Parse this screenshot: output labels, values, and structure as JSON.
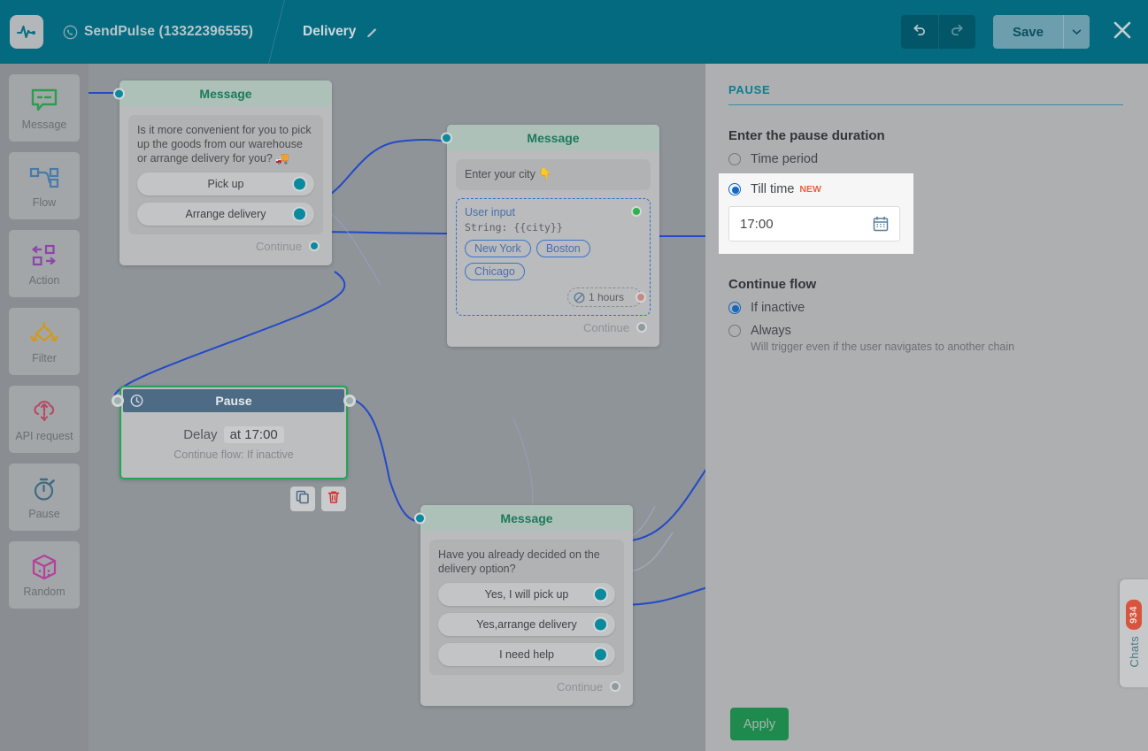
{
  "header": {
    "logo_icon": "pulse-logo-icon",
    "account_icon": "whatsapp-icon",
    "account": "SendPulse (13322396555)",
    "flow_name": "Delivery",
    "edit_icon": "pencil-icon",
    "undo_icon": "undo-icon",
    "redo_icon": "redo-icon",
    "save_label": "Save",
    "save_caret_icon": "chevron-down-icon",
    "close_icon": "close-icon"
  },
  "sidebar": {
    "items": [
      {
        "label": "Message",
        "icon": "message-bubble-icon",
        "color": "#2e9b4f"
      },
      {
        "label": "Flow",
        "icon": "flow-nodes-icon",
        "color": "#4a7aa8"
      },
      {
        "label": "Action",
        "icon": "action-arrows-icon",
        "color": "#8c46a8"
      },
      {
        "label": "Filter",
        "icon": "filter-diamond-icon",
        "color": "#d2991f"
      },
      {
        "label": "API request",
        "icon": "api-cloud-icon",
        "color": "#b84a63"
      },
      {
        "label": "Pause",
        "icon": "stopwatch-icon",
        "color": "#3f6b86"
      },
      {
        "label": "Random",
        "icon": "dice-icon",
        "color": "#b5409b"
      }
    ]
  },
  "canvas": {
    "nodes": {
      "message1": {
        "title": "Message",
        "text": "Is it more convenient for you to pick up the goods from our warehouse or arrange delivery for you? 🚚",
        "buttons": [
          "Pick up",
          "Arrange delivery"
        ],
        "continue_label": "Continue"
      },
      "message2": {
        "title": "Message",
        "text": "Enter your city 👇",
        "user_input": {
          "title": "User input",
          "subtitle": "String: {{city}}",
          "chips": [
            "New York",
            "Boston",
            "Chicago"
          ],
          "timeout_label": "1 hours",
          "timeout_icon": "no-entry-icon"
        },
        "continue_label": "Continue"
      },
      "pause": {
        "title": "Pause",
        "icon": "clock-icon",
        "delay_label": "Delay",
        "delay_value": "at 17:00",
        "subtitle": "Continue flow: If inactive",
        "actions": {
          "copy_icon": "copy-icon",
          "delete_icon": "trash-icon"
        }
      },
      "message3": {
        "title": "Message",
        "text": "Have you already decided on the delivery option?",
        "buttons": [
          "Yes, I will pick up",
          "Yes,arrange delivery",
          "I need help"
        ],
        "continue_label": "Continue"
      }
    }
  },
  "panel": {
    "title": "PAUSE",
    "duration_heading": "Enter the pause duration",
    "duration_options": [
      {
        "label": "Time period",
        "selected": false,
        "badge": ""
      },
      {
        "label": "Till time",
        "selected": true,
        "badge": "NEW"
      }
    ],
    "time_value": "17:00",
    "calendar_icon": "calendar-icon",
    "continue_heading": "Continue flow",
    "continue_options": [
      {
        "label": "If inactive",
        "selected": true
      },
      {
        "label": "Always",
        "selected": false
      }
    ],
    "always_hint": "Will trigger even if the user navigates to another chain",
    "apply_label": "Apply"
  },
  "chats_widget": {
    "count": "934",
    "label": "Chats"
  },
  "colors": {
    "brand_teal": "#046a80",
    "accent_green": "#1f8a4d",
    "edge_blue": "#2349c8",
    "badge_red": "#d9543f",
    "selected_green": "#23a455"
  }
}
